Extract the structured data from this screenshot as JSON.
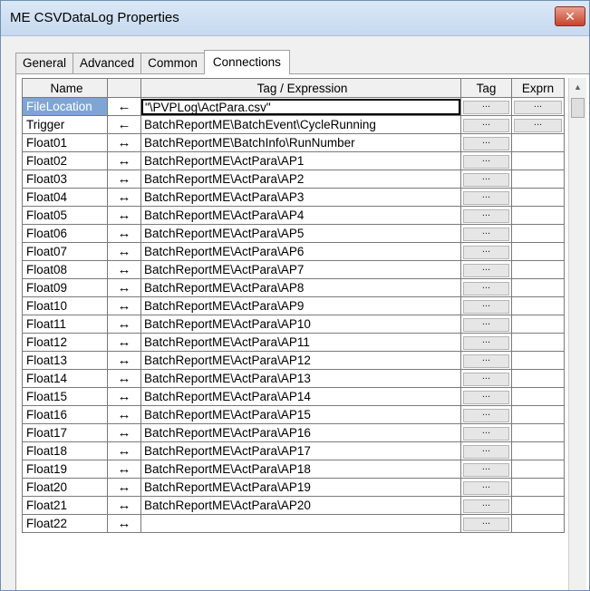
{
  "window": {
    "title": "ME CSVDataLog Properties",
    "close_glyph": "✕"
  },
  "tabs": [
    {
      "label": "General",
      "active": false
    },
    {
      "label": "Advanced",
      "active": false
    },
    {
      "label": "Common",
      "active": false
    },
    {
      "label": "Connections",
      "active": true
    }
  ],
  "grid": {
    "headers": {
      "name": "Name",
      "arrow": "",
      "expression": "Tag / Expression",
      "tag": "Tag",
      "exprn": "Exprn"
    },
    "button_glyph": "...",
    "rows": [
      {
        "name": "FileLocation",
        "direction": "←",
        "expression": "\"\\PVPLog\\ActPara.csv\"",
        "tag_button": true,
        "expr_button": true,
        "selected": true,
        "editing": true
      },
      {
        "name": "Trigger",
        "direction": "←",
        "expression": "BatchReportME\\BatchEvent\\CycleRunning",
        "tag_button": true,
        "expr_button": true
      },
      {
        "name": "Float01",
        "direction": "↔",
        "expression": "BatchReportME\\BatchInfo\\RunNumber",
        "tag_button": true,
        "expr_button": false
      },
      {
        "name": "Float02",
        "direction": "↔",
        "expression": "BatchReportME\\ActPara\\AP1",
        "tag_button": true,
        "expr_button": false
      },
      {
        "name": "Float03",
        "direction": "↔",
        "expression": "BatchReportME\\ActPara\\AP2",
        "tag_button": true,
        "expr_button": false
      },
      {
        "name": "Float04",
        "direction": "↔",
        "expression": "BatchReportME\\ActPara\\AP3",
        "tag_button": true,
        "expr_button": false
      },
      {
        "name": "Float05",
        "direction": "↔",
        "expression": "BatchReportME\\ActPara\\AP4",
        "tag_button": true,
        "expr_button": false
      },
      {
        "name": "Float06",
        "direction": "↔",
        "expression": "BatchReportME\\ActPara\\AP5",
        "tag_button": true,
        "expr_button": false
      },
      {
        "name": "Float07",
        "direction": "↔",
        "expression": "BatchReportME\\ActPara\\AP6",
        "tag_button": true,
        "expr_button": false
      },
      {
        "name": "Float08",
        "direction": "↔",
        "expression": "BatchReportME\\ActPara\\AP7",
        "tag_button": true,
        "expr_button": false
      },
      {
        "name": "Float09",
        "direction": "↔",
        "expression": "BatchReportME\\ActPara\\AP8",
        "tag_button": true,
        "expr_button": false
      },
      {
        "name": "Float10",
        "direction": "↔",
        "expression": "BatchReportME\\ActPara\\AP9",
        "tag_button": true,
        "expr_button": false
      },
      {
        "name": "Float11",
        "direction": "↔",
        "expression": "BatchReportME\\ActPara\\AP10",
        "tag_button": true,
        "expr_button": false
      },
      {
        "name": "Float12",
        "direction": "↔",
        "expression": "BatchReportME\\ActPara\\AP11",
        "tag_button": true,
        "expr_button": false
      },
      {
        "name": "Float13",
        "direction": "↔",
        "expression": "BatchReportME\\ActPara\\AP12",
        "tag_button": true,
        "expr_button": false
      },
      {
        "name": "Float14",
        "direction": "↔",
        "expression": "BatchReportME\\ActPara\\AP13",
        "tag_button": true,
        "expr_button": false
      },
      {
        "name": "Float15",
        "direction": "↔",
        "expression": "BatchReportME\\ActPara\\AP14",
        "tag_button": true,
        "expr_button": false
      },
      {
        "name": "Float16",
        "direction": "↔",
        "expression": "BatchReportME\\ActPara\\AP15",
        "tag_button": true,
        "expr_button": false
      },
      {
        "name": "Float17",
        "direction": "↔",
        "expression": "BatchReportME\\ActPara\\AP16",
        "tag_button": true,
        "expr_button": false
      },
      {
        "name": "Float18",
        "direction": "↔",
        "expression": "BatchReportME\\ActPara\\AP17",
        "tag_button": true,
        "expr_button": false
      },
      {
        "name": "Float19",
        "direction": "↔",
        "expression": "BatchReportME\\ActPara\\AP18",
        "tag_button": true,
        "expr_button": false
      },
      {
        "name": "Float20",
        "direction": "↔",
        "expression": "BatchReportME\\ActPara\\AP19",
        "tag_button": true,
        "expr_button": false
      },
      {
        "name": "Float21",
        "direction": "↔",
        "expression": "BatchReportME\\ActPara\\AP20",
        "tag_button": true,
        "expr_button": false
      },
      {
        "name": "Float22",
        "direction": "↔",
        "expression": "",
        "tag_button": true,
        "expr_button": false
      }
    ]
  },
  "scrollbar": {
    "up_glyph": "▲"
  }
}
